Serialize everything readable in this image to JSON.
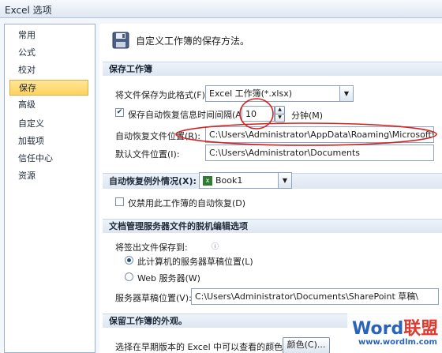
{
  "window": {
    "title": "Excel 选项"
  },
  "sidebar": {
    "items": [
      {
        "label": "常用"
      },
      {
        "label": "公式"
      },
      {
        "label": "校对"
      },
      {
        "label": "保存"
      },
      {
        "label": "高级"
      },
      {
        "label": "自定义"
      },
      {
        "label": "加载项"
      },
      {
        "label": "信任中心"
      },
      {
        "label": "资源"
      }
    ],
    "active": "保存"
  },
  "header": {
    "text": "自定义工作簿的保存方法。"
  },
  "save_section": {
    "title": "保存工作簿",
    "format_label": "将文件保存为此格式(F):",
    "format_value": "Excel 工作簿(*.xlsx)",
    "autorecover_label": "保存自动恢复信息时间间隔(A)",
    "autorecover_checked": true,
    "interval_value": "10",
    "minutes_label": "分钟(M)",
    "autorecover_location_label": "自动恢复文件位置(R):",
    "autorecover_location_value": "C:\\Users\\Administrator\\AppData\\Roaming\\Microsoft\\Excel\\",
    "default_location_label": "默认文件位置(I):",
    "default_location_value": "C:\\Users\\Administrator\\Documents"
  },
  "exceptions_section": {
    "title": "自动恢复例外情况(X):",
    "workbook_value": "Book1",
    "disable_label": "仅禁用此工作簿的自动恢复(D)",
    "disable_checked": false
  },
  "offline_section": {
    "title": "文档管理服务器文件的脱机编辑选项",
    "save_to_label": "将签出文件保存到:",
    "radio_local": "此计算机的服务器草稿位置(L)",
    "radio_server": "Web 服务器(W)",
    "selected": "local",
    "drafts_label": "服务器草稿位置(V):",
    "drafts_value": "C:\\Users\\Administrator\\Documents\\SharePoint 草稿\\"
  },
  "appearance_section": {
    "title": "保留工作簿的外观。",
    "colors_label": "选择在早期版本的 Excel 中可以查看的颜色:",
    "colors_button": "颜色(C)..."
  },
  "watermark": {
    "brand_a": "Word",
    "brand_b": "联盟",
    "url": "www.wordlm.com"
  },
  "colors": {
    "accent_circle": "#d62020",
    "section_bg": "#dde6f1",
    "active_nav": "#ffd35c"
  }
}
